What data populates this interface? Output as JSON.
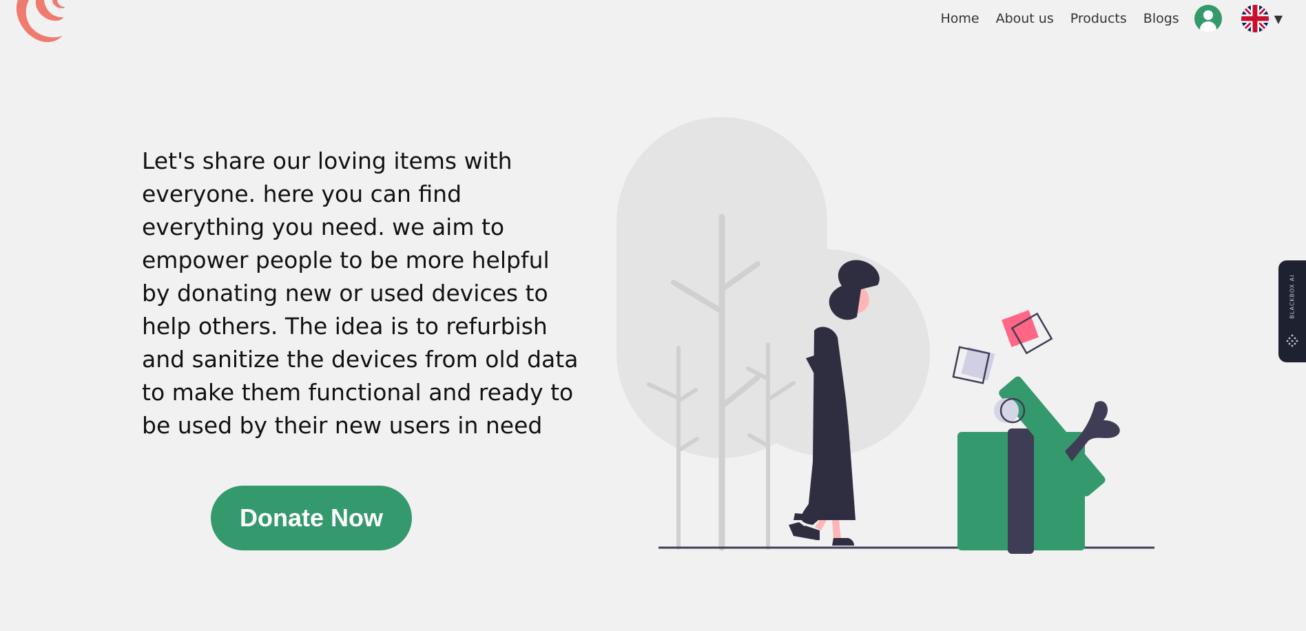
{
  "nav": {
    "links": [
      "Home",
      "About us",
      "Products",
      "Blogs"
    ],
    "profile_icon": "user-icon",
    "language_icon": "uk-flag-icon",
    "caret_icon": "caret-down-icon",
    "caret_glyph": "▼"
  },
  "hero": {
    "text": "Let's share our loving items with everyone. here you can find everything you need. we aim to empower people to be more helpful by donating new or used devices to help others. The idea is to refurbish and sanitize the devices from old data to make them functional and ready to be used by their new users in need",
    "button_label": "Donate Now"
  },
  "side_widget": {
    "label": "BLACKBOX AI"
  },
  "colors": {
    "background": "#f1f1f1",
    "accent": "#34996c",
    "logo": "#ef7b6e",
    "figure_dark": "#2f2e41",
    "gift_ribbon": "#3f3d56",
    "pink": "#ff6584"
  }
}
